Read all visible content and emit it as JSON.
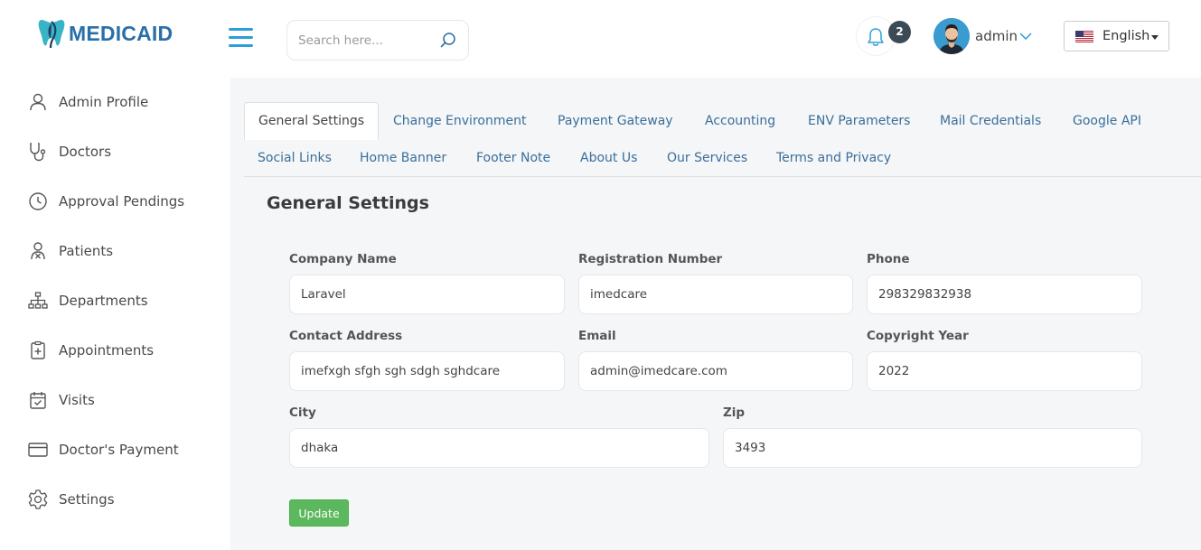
{
  "brand": {
    "name": "MEDICAID",
    "color": "#2a6fa8",
    "icon": "tooth-leaf-logo"
  },
  "header": {
    "search_placeholder": "Search here...",
    "notifications_count": "2",
    "user_name": "admin",
    "language": "English"
  },
  "sidebar": {
    "items": [
      {
        "label": "Admin Profile",
        "icon": "user-icon"
      },
      {
        "label": "Doctors",
        "icon": "stethoscope-icon"
      },
      {
        "label": "Approval Pendings",
        "icon": "clock-icon"
      },
      {
        "label": "Patients",
        "icon": "patient-icon"
      },
      {
        "label": "Departments",
        "icon": "sitemap-icon"
      },
      {
        "label": "Appointments",
        "icon": "clipboard-plus-icon"
      },
      {
        "label": "Visits",
        "icon": "calendar-check-icon"
      },
      {
        "label": "Doctor's Payment",
        "icon": "credit-card-icon"
      },
      {
        "label": "Settings",
        "icon": "gear-icon"
      }
    ]
  },
  "tabs": [
    "General Settings",
    "Change Environment",
    "Payment Gateway",
    "Accounting",
    "ENV Parameters",
    "Mail Credentials",
    "Google API",
    "Social Links",
    "Home Banner",
    "Footer Note",
    "About Us",
    "Our Services",
    "Terms and Privacy"
  ],
  "active_tab": "General Settings",
  "form": {
    "title": "General Settings",
    "company_name": {
      "label": "Company Name",
      "value": "Laravel"
    },
    "registration_number": {
      "label": "Registration Number",
      "value": "imedcare"
    },
    "phone": {
      "label": "Phone",
      "value": "298329832938"
    },
    "contact_address": {
      "label": "Contact Address",
      "value": "imefxgh sfgh sgh sdgh sghdcare"
    },
    "email": {
      "label": "Email",
      "value": "admin@imedcare.com"
    },
    "copyright_year": {
      "label": "Copyright Year",
      "value": "2022"
    },
    "city": {
      "label": "City",
      "value": "dhaka"
    },
    "zip": {
      "label": "Zip",
      "value": "3493"
    },
    "submit_label": "Update"
  },
  "colors": {
    "accent": "#2b9fd9",
    "tab_link": "#3a6e9a",
    "submit": "#5cb85c",
    "badge": "#3c4a55"
  }
}
